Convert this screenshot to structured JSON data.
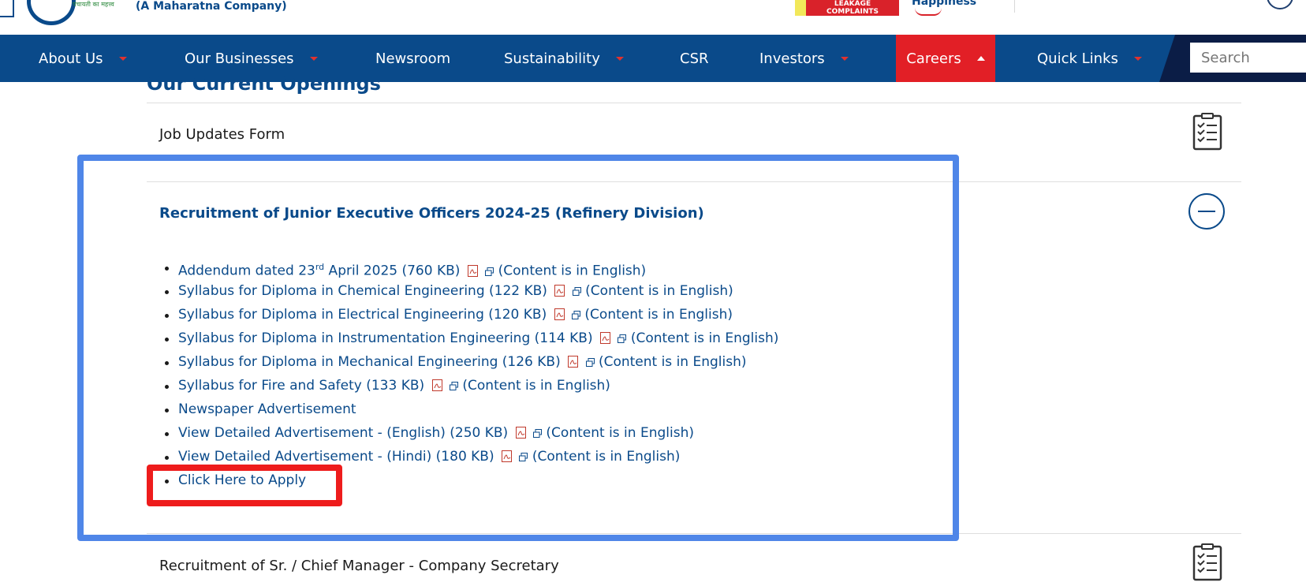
{
  "header": {
    "hindi_mark": "पंचायती का महत्त्व",
    "tagline": "(A Maharatna Company)",
    "badge_text_1": "LEAKAGE",
    "badge_text_2": "COMPLAINTS",
    "happiness_text": "Happiness"
  },
  "nav": {
    "items": [
      {
        "label": "About Us"
      },
      {
        "label": "Our Businesses"
      },
      {
        "label": "Newsroom"
      },
      {
        "label": "Sustainability"
      },
      {
        "label": "CSR"
      },
      {
        "label": "Investors"
      },
      {
        "label": "Careers"
      },
      {
        "label": "Quick Links"
      }
    ],
    "search_placeholder": "Search"
  },
  "content": {
    "section_title": "Our Current Openings",
    "rows": [
      {
        "title": "Job Updates Form"
      },
      {
        "title": "Recruitment of Junior Executive Officers 2024-25 (Refinery Division)"
      },
      {
        "title": "Recruitment of Sr. / Chief Manager - Company Secretary"
      }
    ],
    "links": [
      {
        "text_a": "Addendum dated 23",
        "sup": "rd",
        "text_b": " April 2025 (760 KB)",
        "note": "(Content is in English)"
      },
      {
        "text": "Syllabus for Diploma in Chemical Engineering (122 KB)",
        "note": "(Content is in English)"
      },
      {
        "text": "Syllabus for Diploma in Electrical Engineering (120 KB)",
        "note": "(Content is in English)"
      },
      {
        "text": "Syllabus for Diploma in Instrumentation Engineering (114 KB)",
        "note": "(Content is in English)"
      },
      {
        "text": "Syllabus for Diploma in Mechanical Engineering (126 KB)",
        "note": "(Content is in English)"
      },
      {
        "text": "Syllabus for Fire and Safety (133 KB)",
        "note": "(Content is in English)"
      },
      {
        "text": "Newspaper Advertisement"
      },
      {
        "text": "View Detailed Advertisement - (English) (250 KB)",
        "note": "(Content is in English)"
      },
      {
        "text": "View Detailed Advertisement - (Hindi) (180 KB)",
        "note": "(Content is in English)"
      },
      {
        "text": "Click Here to Apply"
      }
    ]
  },
  "colors": {
    "nav_bg": "#0a4a8a",
    "careers_bg": "#e21f26",
    "highlight_blue": "#4f86e8",
    "highlight_red": "#ee1c1c"
  }
}
